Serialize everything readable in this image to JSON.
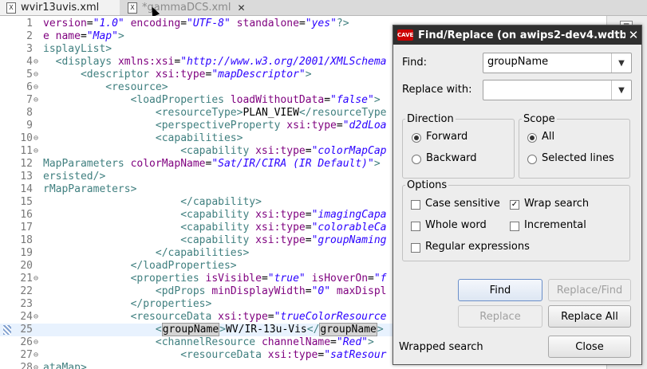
{
  "tabs": [
    {
      "label": "wvir13uvis.xml",
      "icon": "X",
      "active": true
    },
    {
      "label": "*gammaDCS.xml",
      "icon": "X",
      "active": false
    }
  ],
  "editor": {
    "lines": [
      {
        "num": "1",
        "fold": "",
        "seg": [
          [
            "t-attr",
            "version"
          ],
          [
            "t-text",
            "="
          ],
          [
            "t-val",
            "\"1.0\""
          ],
          [
            "t-text",
            " "
          ],
          [
            "t-attr",
            "encoding"
          ],
          [
            "t-text",
            "="
          ],
          [
            "t-val",
            "\"UTF-8\""
          ],
          [
            "t-text",
            " "
          ],
          [
            "t-attr",
            "standalone"
          ],
          [
            "t-text",
            "="
          ],
          [
            "t-val",
            "\"yes\""
          ],
          [
            "t-tag",
            "?>"
          ]
        ]
      },
      {
        "num": "2",
        "fold": "",
        "seg": [
          [
            "t-attr",
            "e name"
          ],
          [
            "t-text",
            "="
          ],
          [
            "t-val",
            "\"Map\""
          ],
          [
            "t-tag",
            ">"
          ]
        ]
      },
      {
        "num": "3",
        "fold": "",
        "seg": [
          [
            "t-tag",
            "isplayList>"
          ]
        ]
      },
      {
        "num": "4",
        "fold": "⊖",
        "seg": [
          [
            "t-text",
            "  "
          ],
          [
            "t-tag",
            "<displays "
          ],
          [
            "t-attr",
            "xmlns:xsi"
          ],
          [
            "t-text",
            "="
          ],
          [
            "t-val",
            "\"http://www.w3.org/2001/XMLSchema"
          ]
        ]
      },
      {
        "num": "5",
        "fold": "⊖",
        "seg": [
          [
            "t-text",
            "      "
          ],
          [
            "t-tag",
            "<descriptor "
          ],
          [
            "t-attr",
            "xsi:type"
          ],
          [
            "t-text",
            "="
          ],
          [
            "t-val",
            "\"mapDescriptor\""
          ],
          [
            "t-tag",
            ">"
          ]
        ]
      },
      {
        "num": "6",
        "fold": "⊖",
        "seg": [
          [
            "t-text",
            "          "
          ],
          [
            "t-tag",
            "<resource>"
          ]
        ]
      },
      {
        "num": "7",
        "fold": "⊖",
        "seg": [
          [
            "t-text",
            "              "
          ],
          [
            "t-tag",
            "<loadProperties "
          ],
          [
            "t-attr",
            "loadWithoutData"
          ],
          [
            "t-text",
            "="
          ],
          [
            "t-val",
            "\"false\""
          ],
          [
            "t-tag",
            ">"
          ]
        ]
      },
      {
        "num": "8",
        "fold": "",
        "seg": [
          [
            "t-text",
            "                  "
          ],
          [
            "t-tag",
            "<resourceType>"
          ],
          [
            "t-text",
            "PLAN_VIEW"
          ],
          [
            "t-tag",
            "</resourceType"
          ]
        ]
      },
      {
        "num": "9",
        "fold": "",
        "seg": [
          [
            "t-text",
            "                  "
          ],
          [
            "t-tag",
            "<perspectiveProperty "
          ],
          [
            "t-attr",
            "xsi:type"
          ],
          [
            "t-text",
            "="
          ],
          [
            "t-val",
            "\"d2dLoa"
          ]
        ]
      },
      {
        "num": "10",
        "fold": "⊖",
        "seg": [
          [
            "t-text",
            "                  "
          ],
          [
            "t-tag",
            "<capabilities>"
          ]
        ]
      },
      {
        "num": "11",
        "fold": "⊖",
        "seg": [
          [
            "t-text",
            "                      "
          ],
          [
            "t-tag",
            "<capability "
          ],
          [
            "t-attr",
            "xsi:type"
          ],
          [
            "t-text",
            "="
          ],
          [
            "t-val",
            "\"colorMapCap"
          ]
        ]
      },
      {
        "num": "12",
        "fold": "",
        "seg": [
          [
            "t-tag",
            "MapParameters "
          ],
          [
            "t-attr",
            "colorMapName"
          ],
          [
            "t-text",
            "="
          ],
          [
            "t-val",
            "\"Sat/IR/CIRA (IR Default)\""
          ],
          [
            "t-tag",
            ">"
          ]
        ]
      },
      {
        "num": "13",
        "fold": "",
        "seg": [
          [
            "t-tag",
            "ersisted/>"
          ]
        ]
      },
      {
        "num": "14",
        "fold": "",
        "seg": [
          [
            "t-tag",
            "rMapParameters>"
          ]
        ]
      },
      {
        "num": "15",
        "fold": "",
        "seg": [
          [
            "t-text",
            "                      "
          ],
          [
            "t-tag",
            "</capability>"
          ]
        ]
      },
      {
        "num": "16",
        "fold": "",
        "seg": [
          [
            "t-text",
            "                      "
          ],
          [
            "t-tag",
            "<capability "
          ],
          [
            "t-attr",
            "xsi:type"
          ],
          [
            "t-text",
            "="
          ],
          [
            "t-val",
            "\"imagingCapa"
          ]
        ]
      },
      {
        "num": "17",
        "fold": "",
        "seg": [
          [
            "t-text",
            "                      "
          ],
          [
            "t-tag",
            "<capability "
          ],
          [
            "t-attr",
            "xsi:type"
          ],
          [
            "t-text",
            "="
          ],
          [
            "t-val",
            "\"colorableCa"
          ]
        ]
      },
      {
        "num": "18",
        "fold": "",
        "seg": [
          [
            "t-text",
            "                      "
          ],
          [
            "t-tag",
            "<capability "
          ],
          [
            "t-attr",
            "xsi:type"
          ],
          [
            "t-text",
            "="
          ],
          [
            "t-val",
            "\"groupNaming"
          ]
        ]
      },
      {
        "num": "19",
        "fold": "",
        "seg": [
          [
            "t-text",
            "                  "
          ],
          [
            "t-tag",
            "</capabilities>"
          ]
        ]
      },
      {
        "num": "20",
        "fold": "",
        "seg": [
          [
            "t-text",
            "              "
          ],
          [
            "t-tag",
            "</loadProperties>"
          ]
        ]
      },
      {
        "num": "21",
        "fold": "⊖",
        "seg": [
          [
            "t-text",
            "              "
          ],
          [
            "t-tag",
            "<properties "
          ],
          [
            "t-attr",
            "isVisible"
          ],
          [
            "t-text",
            "="
          ],
          [
            "t-val",
            "\"true\""
          ],
          [
            "t-text",
            " "
          ],
          [
            "t-attr",
            "isHoverOn"
          ],
          [
            "t-text",
            "="
          ],
          [
            "t-val",
            "\"f"
          ]
        ]
      },
      {
        "num": "22",
        "fold": "",
        "seg": [
          [
            "t-text",
            "                  "
          ],
          [
            "t-tag",
            "<pdProps "
          ],
          [
            "t-attr",
            "minDisplayWidth"
          ],
          [
            "t-text",
            "="
          ],
          [
            "t-val",
            "\"0\""
          ],
          [
            "t-text",
            " "
          ],
          [
            "t-attr",
            "maxDispl"
          ]
        ]
      },
      {
        "num": "23",
        "fold": "",
        "seg": [
          [
            "t-text",
            "              "
          ],
          [
            "t-tag",
            "</properties>"
          ]
        ]
      },
      {
        "num": "24",
        "fold": "⊖",
        "seg": [
          [
            "t-text",
            "              "
          ],
          [
            "t-tag",
            "<resourceData "
          ],
          [
            "t-attr",
            "xsi:type"
          ],
          [
            "t-text",
            "="
          ],
          [
            "t-val",
            "\"trueColorResource"
          ]
        ]
      },
      {
        "num": "25",
        "fold": "",
        "hl": true,
        "seg": [
          [
            "t-text",
            "                  "
          ],
          [
            "t-tag",
            "<"
          ],
          [
            "t-match",
            "groupName"
          ],
          [
            "t-tag",
            ">"
          ],
          [
            "t-text",
            "WV/IR-13u-Vis"
          ],
          [
            "t-tag",
            "</"
          ],
          [
            "t-match",
            "groupName"
          ],
          [
            "t-tag",
            ">"
          ]
        ]
      },
      {
        "num": "26",
        "fold": "⊖",
        "seg": [
          [
            "t-text",
            "                  "
          ],
          [
            "t-tag",
            "<channelResource "
          ],
          [
            "t-attr",
            "channelName"
          ],
          [
            "t-text",
            "="
          ],
          [
            "t-val",
            "\"Red\""
          ],
          [
            "t-tag",
            ">"
          ]
        ]
      },
      {
        "num": "27",
        "fold": "⊖",
        "seg": [
          [
            "t-text",
            "                      "
          ],
          [
            "t-tag",
            "<resourceData "
          ],
          [
            "t-attr",
            "xsi:type"
          ],
          [
            "t-text",
            "="
          ],
          [
            "t-val",
            "\"satResour"
          ]
        ]
      },
      {
        "num": "28",
        "fold": "⊖",
        "seg": [
          [
            "t-tag",
            "ataMap>"
          ]
        ]
      }
    ]
  },
  "dialog": {
    "title": "Find/Replace  (on awips2-dev4.wdtb",
    "logo_text": "CAVE",
    "find_label": "Find:",
    "find_value": "groupName",
    "replace_label": "Replace with:",
    "replace_value": "",
    "direction": {
      "title": "Direction",
      "forward": "Forward",
      "backward": "Backward",
      "selected": "forward"
    },
    "scope": {
      "title": "Scope",
      "all": "All",
      "selected_lines": "Selected lines",
      "selected": "all"
    },
    "options": {
      "title": "Options",
      "case_sensitive": {
        "label": "Case sensitive",
        "checked": false
      },
      "wrap_search": {
        "label": "Wrap search",
        "checked": true
      },
      "whole_word": {
        "label": "Whole word",
        "checked": false
      },
      "incremental": {
        "label": "Incremental",
        "checked": false
      },
      "regex": {
        "label": "Regular expressions",
        "checked": false
      }
    },
    "buttons": {
      "find": "Find",
      "replace_find": "Replace/Find",
      "replace": "Replace",
      "replace_all": "Replace All",
      "close": "Close"
    },
    "status": "Wrapped search"
  }
}
